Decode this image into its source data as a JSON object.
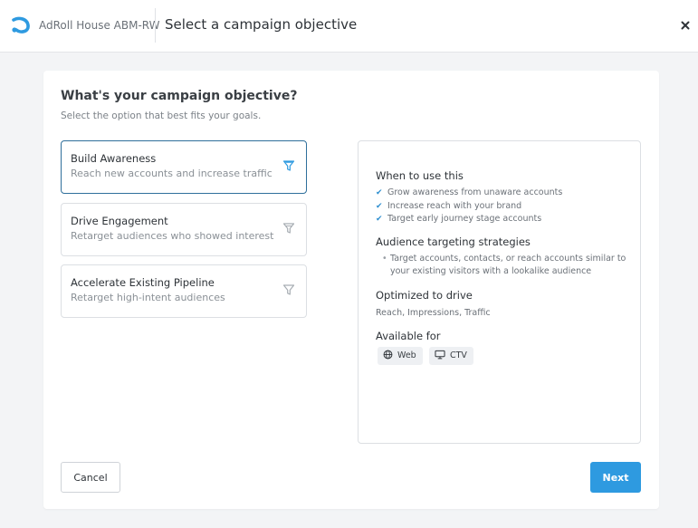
{
  "header": {
    "org_name": "AdRoll House ABM-RW",
    "title": "Select a campaign objective",
    "close_icon": "close-icon"
  },
  "main": {
    "heading": "What's your campaign objective?",
    "subheading": "Select the option that best fits your goals.",
    "options": [
      {
        "title": "Build Awareness",
        "description": "Reach new accounts and increase traffic",
        "icon": "funnel-icon",
        "selected": true
      },
      {
        "title": "Drive Engagement",
        "description": "Retarget audiences who showed interest",
        "icon": "funnel-icon",
        "selected": false
      },
      {
        "title": "Accelerate Existing Pipeline",
        "description": "Retarget high-intent audiences",
        "icon": "funnel-icon",
        "selected": false
      }
    ],
    "details": {
      "when_title": "When to use this",
      "when_items": [
        "Grow awareness from unaware accounts",
        "Increase reach with your brand",
        "Target early journey stage accounts"
      ],
      "strategies_title": "Audience targeting strategies",
      "strategies_items": [
        "Target accounts, contacts, or reach accounts similar to your existing visitors with a lookalike audience"
      ],
      "optimized_title": "Optimized to drive",
      "optimized_text": "Reach, Impressions, Traffic",
      "available_title": "Available for",
      "available_items": [
        {
          "label": "Web",
          "icon": "globe-icon"
        },
        {
          "label": "CTV",
          "icon": "monitor-icon"
        }
      ]
    }
  },
  "footer": {
    "cancel_label": "Cancel",
    "next_label": "Next"
  },
  "colors": {
    "accent": "#2e9ae0",
    "selected_border": "#2f6f9b",
    "check": "#2f8fd0"
  }
}
